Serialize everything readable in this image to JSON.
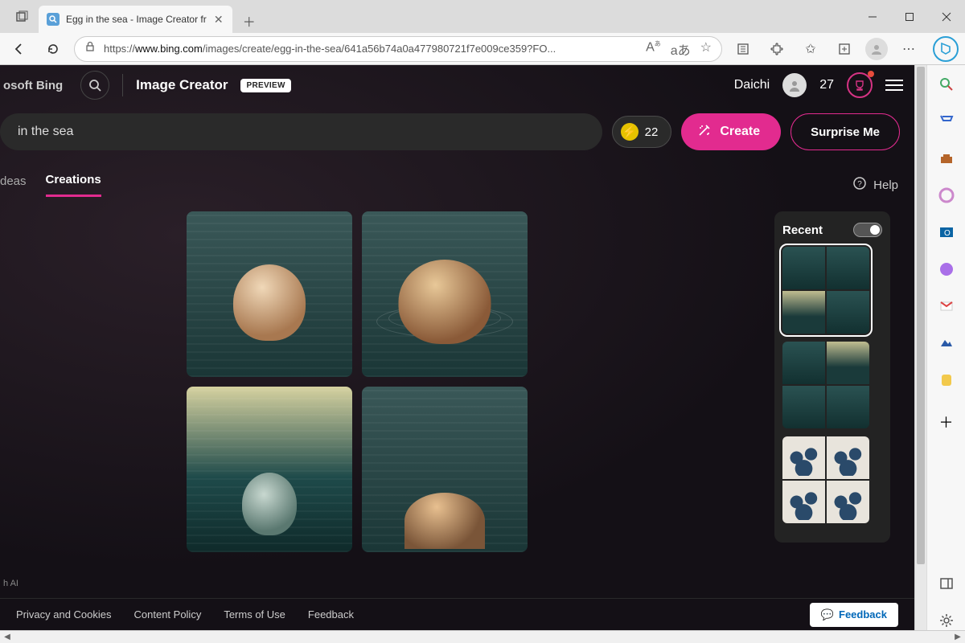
{
  "browser": {
    "tab_title": "Egg in the sea - Image Creator fr",
    "url_prefix": "https://",
    "url_domain": "www.bing.com",
    "url_path": "/images/create/egg-in-the-sea/641a56b74a0a477980721f7e009ce359?FO..."
  },
  "header": {
    "brand": "osoft Bing",
    "title": "Image Creator",
    "badge": "PREVIEW",
    "username": "Daichi",
    "points": "27"
  },
  "prompt": {
    "text": "in the sea",
    "boosts": "22",
    "create": "Create",
    "surprise": "Surprise Me"
  },
  "tabs": {
    "ideas": "deas",
    "creations": "Creations",
    "help": "Help"
  },
  "recent": {
    "title": "Recent"
  },
  "watermark": "h AI",
  "footer": {
    "privacy": "Privacy and Cookies",
    "content": "Content Policy",
    "terms": "Terms of Use",
    "feedback_left": "Feedback",
    "feedback_btn": "Feedback"
  }
}
